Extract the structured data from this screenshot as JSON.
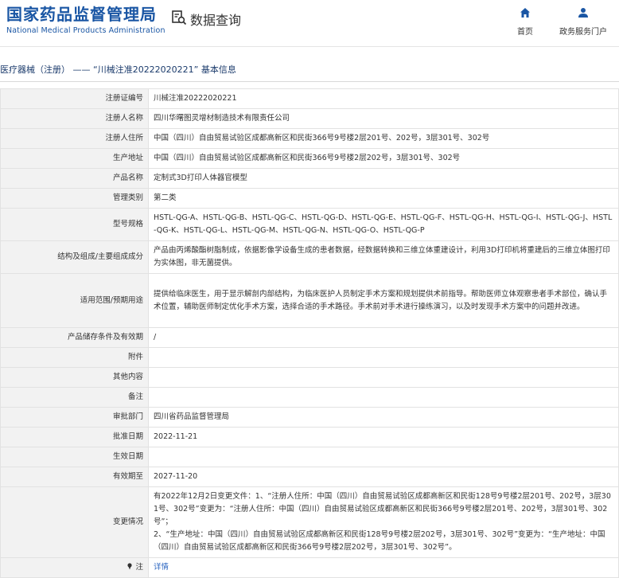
{
  "header": {
    "logo_cn": "国家药品监督管理局",
    "logo_en": "National Medical Products Administration",
    "query_label": "数据查询",
    "nav": [
      {
        "label": "首页",
        "icon": "home-icon"
      },
      {
        "label": "政务服务门户",
        "icon": "user-icon"
      }
    ]
  },
  "breadcrumb": "医疗器械（注册） —— “川械注准20222020221” 基本信息",
  "colors": {
    "brand": "#1a56a4",
    "link": "#2a64c0",
    "label_bg": "#f2f2f2"
  },
  "rows": [
    {
      "label": "注册证编号",
      "value": "川械注准20222020221"
    },
    {
      "label": "注册人名称",
      "value": "四川华曙图灵增材制造技术有限责任公司"
    },
    {
      "label": "注册人住所",
      "value": "中国（四川）自由贸易试验区成都高新区和民街366号9号楼2层201号、202号，3层301号、302号"
    },
    {
      "label": "生产地址",
      "value": "中国（四川）自由贸易试验区成都高新区和民街366号9号楼2层202号，3层301号、302号"
    },
    {
      "label": "产品名称",
      "value": "定制式3D打印人体器官模型"
    },
    {
      "label": "管理类别",
      "value": "第二类"
    },
    {
      "label": "型号规格",
      "value": "HSTL-QG-A、HSTL-QG-B、HSTL-QG-C、HSTL-QG-D、HSTL-QG-E、HSTL-QG-F、HSTL-QG-H、HSTL-QG-I、HSTL-QG-J、HSTL-QG-K、HSTL-QG-L、HSTL-QG-M、HSTL-QG-N、HSTL-QG-O、HSTL-QG-P"
    },
    {
      "label": "结构及组成/主要组成成分",
      "value": "产品由丙烯酸酯树脂制成，依据影像学设备生成的患者数据，经数据转换和三维立体重建设计，利用3D打印机将重建后的三维立体图打印为实体图，非无菌提供。"
    },
    {
      "label": "适用范围/预期用途",
      "value": "提供给临床医生，用于显示解剖内部结构，为临床医护人员制定手术方案和规划提供术前指导。帮助医师立体观察患者手术部位，确认手术位置，辅助医师制定优化手术方案，选择合适的手术路径。手术前对手术进行操练演习，以及时发现手术方案中的问题并改进。"
    },
    {
      "label": "产品储存条件及有效期",
      "value": "/"
    },
    {
      "label": "附件",
      "value": ""
    },
    {
      "label": "其他内容",
      "value": ""
    },
    {
      "label": "备注",
      "value": ""
    },
    {
      "label": "审批部门",
      "value": "四川省药品监督管理局"
    },
    {
      "label": "批准日期",
      "value": "2022-11-21"
    },
    {
      "label": "生效日期",
      "value": ""
    },
    {
      "label": "有效期至",
      "value": "2027-11-20"
    },
    {
      "label": "变更情况",
      "value": "有2022年12月2日变更文件：1、“注册人住所：中国（四川）自由贸易试验区成都高新区和民街128号9号楼2层201号、202号，3层301号、302号”变更为：“注册人住所：中国（四川）自由贸易试验区成都高新区和民街366号9号楼2层201号、202号，3层301号、302号”；\n2、“生产地址：中国（四川）自由贸易试验区成都高新区和民街128号9号楼2层202号，3层301号、302号”变更为：“生产地址：中国（四川）自由贸易试验区成都高新区和民街366号9号楼2层202号，3层301号、302号”。"
    }
  ],
  "note": {
    "label": "注",
    "link": "详情",
    "icon": "pin-icon"
  }
}
